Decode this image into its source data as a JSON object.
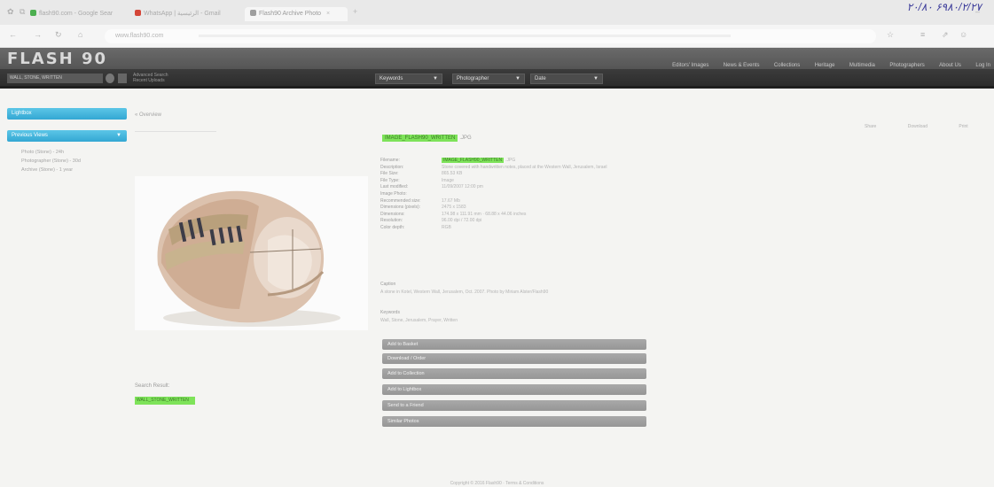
{
  "browser": {
    "scan_note": "۲۰/۸۰ ۶۹۸۰/۲/۲۷",
    "tabs": [
      {
        "label": "flash90.com - Google Sear",
        "color": "#4caf50"
      },
      {
        "label": "WhatsApp | الرئيسية - Gmail",
        "color": "#d44638"
      },
      {
        "label": "Flash90 Archive Photo",
        "color": "#9e9e9e"
      }
    ],
    "url": "www.flash90.com"
  },
  "site": {
    "logo": "FLASH 90",
    "nav": [
      "Editors' Images",
      "News & Events",
      "Collections",
      "Heritage",
      "Multimedia",
      "Photographers",
      "About Us",
      "Log In"
    ],
    "search_value": "WALL, STONE, WRITTEN",
    "advanced_link_1": "Advanced Search",
    "advanced_link_2": "Recent Uploads",
    "filters": [
      "Keywords",
      "Photographer",
      "Date"
    ]
  },
  "sidebar": {
    "btn1": "Lightbox",
    "btn2": "Previous Views",
    "items": [
      "Photo (Stone) - 24h",
      "Photographer (Stone) - 30d",
      "Archive (Stone) - 1 year"
    ]
  },
  "main": {
    "breadcrumb": "« Overview",
    "file_name": "IMAGE_FLASH90_WRITTEN",
    "file_ext": ".JPG",
    "metadata": [
      {
        "k": "Filename:",
        "v": "IMAGE_FLASH90_WRITTEN",
        "v2": ".JPG",
        "hl": true
      },
      {
        "k": "Description:",
        "v": "Stone covered with handwritten notes, placed at the Western Wall, Jerusalem, Israel",
        "hl": false
      },
      {
        "k": "File Size:",
        "v": "865.53 KB",
        "hl": false
      },
      {
        "k": "File Type:",
        "v": "Image",
        "hl": false
      },
      {
        "k": "Last modified:",
        "v": "11/09/2007 12:00 pm",
        "hl": false
      },
      {
        "k": "Image Photo:",
        "v": "",
        "hl": false
      },
      {
        "k": "Recommended size:",
        "v": "17.67 Mb",
        "hl": false
      },
      {
        "k": "Dimensions (pixels):",
        "v": "2475 x 1583",
        "hl": false
      },
      {
        "k": "Dimensions:",
        "v": "174.98 x 111.91 mm · 68.88 x 44.06 inches",
        "hl": false
      },
      {
        "k": "Resolution:",
        "v": "96.00 dpi / 72.00 dpi",
        "hl": false
      },
      {
        "k": "Color depth:",
        "v": "RGB",
        "hl": false
      }
    ],
    "caption_h": "Caption",
    "caption_t": "A stone in Kotel, Western Wall, Jerusalem, Oct. 2007. Photo by Miriam Alster/Flash90",
    "keywords_h": "Keywords",
    "keywords_t": "Wall, Stone, Jerusalem, Prayer, Written",
    "accordions": [
      "Add to Basket",
      "Download / Order",
      "Add to Collection",
      "Add to Lightbox",
      "Send to a Friend",
      "Similar Photos"
    ],
    "search_result_label": "Search Result:",
    "search_result_tag": "WALL_STONE_WRITTEN"
  },
  "right_tools": [
    "Share",
    "Download",
    "Print"
  ],
  "footer": "Copyright © 2016 Flash90 · Terms & Conditions"
}
